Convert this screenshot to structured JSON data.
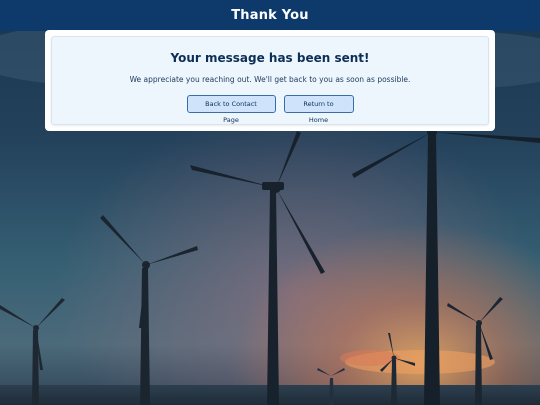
{
  "header": {
    "title": "Thank You"
  },
  "card": {
    "heading": "Your message has been sent!",
    "message": "We appreciate you reaching out. We'll get back to you as soon as possible.",
    "buttons": {
      "back_label": "Back to Contact Page",
      "home_label": "Return to Home"
    }
  },
  "background": {
    "scene": "wind-turbines-at-sunset"
  },
  "colors": {
    "header_bg": "#0e3a6b",
    "heading_text": "#0d2f57",
    "button_bg": "#cfe3fb",
    "button_border": "#3b6ea8",
    "card_bg": "#edf5fd"
  }
}
